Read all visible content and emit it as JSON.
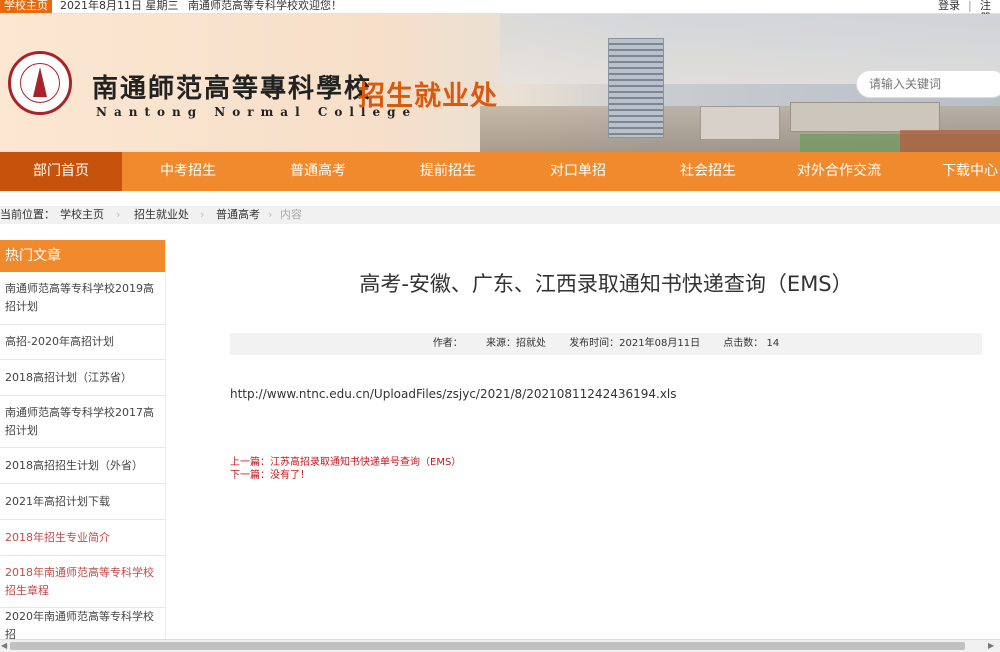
{
  "topbar": {
    "home": "学校主页",
    "date": "2021年8月11日 星期三",
    "welcome": "南通师范高等专科学校欢迎您！",
    "login": "登录",
    "separator": "|",
    "register": "注册"
  },
  "header": {
    "school_cn": "南通師范高等專科學校",
    "school_en": "Nantong Normal College",
    "dept": "招生就业处",
    "search_placeholder": "请输入关键词"
  },
  "nav": {
    "items": [
      "部门首页",
      "中考招生",
      "普通高考",
      "提前招生",
      "对口单招",
      "社会招生",
      "对外合作交流",
      "下载中心"
    ]
  },
  "breadcrumb": {
    "label": "当前位置：",
    "items": [
      "学校主页",
      "招生就业处",
      "普通高考",
      "内容"
    ],
    "arrow": "›"
  },
  "sidebar": {
    "title": "热门文章",
    "items": [
      "南通师范高等专科学校2019高招计划",
      "高招-2020年高招计划",
      "2018高招计划（江苏省）",
      "南通师范高等专科学校2017高招计划",
      "2018高招招生计划（外省）",
      "2021年高招计划下载",
      "2018年招生专业简介",
      "2018年南通师范高等专科学校招生章程",
      "2020年南通师范高等专科学校招"
    ]
  },
  "article": {
    "title": "高考-安徽、广东、江西录取通知书快递查询（EMS）",
    "meta": {
      "author": "作者：",
      "source": "来源：招就处",
      "date": "发布时间：2021年08月11日",
      "clicks": "点击数： 14"
    },
    "link": "http://www.ntnc.edu.cn/UploadFiles/zsjyc/2021/8/20210811242436194.xls",
    "prev_label": "上一篇：",
    "prev_text": "江苏高招录取通知书快递单号查询（EMS）",
    "next_label": "下一篇：",
    "next_text": "没有了！"
  },
  "colors": {
    "nav": "#f08a2c",
    "nav_active": "#c7520c",
    "accent": "#d95a0e",
    "link_red": "#c8161d"
  }
}
